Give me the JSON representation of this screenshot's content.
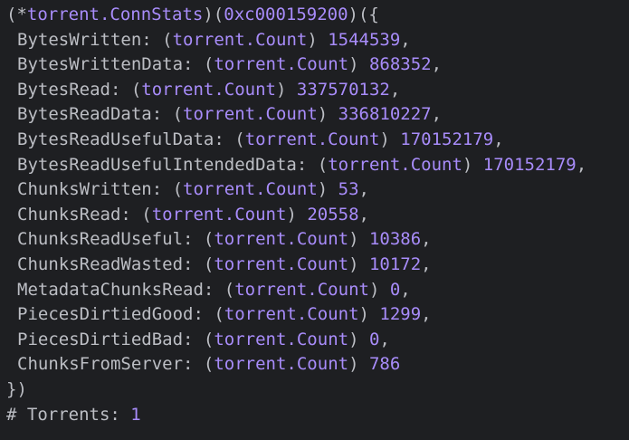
{
  "header": {
    "open_paren": "(*",
    "type_name": "torrent.ConnStats",
    "close_paren": ")(",
    "address": "0xc000159200",
    "suffix": ")({"
  },
  "fields": [
    {
      "name": "BytesWritten",
      "type": "torrent.Count",
      "value": "1544539",
      "sep": ","
    },
    {
      "name": "BytesWrittenData",
      "type": "torrent.Count",
      "value": "868352",
      "sep": ","
    },
    {
      "name": "BytesRead",
      "type": "torrent.Count",
      "value": "337570132",
      "sep": ","
    },
    {
      "name": "BytesReadData",
      "type": "torrent.Count",
      "value": "336810227",
      "sep": ","
    },
    {
      "name": "BytesReadUsefulData",
      "type": "torrent.Count",
      "value": "170152179",
      "sep": ","
    },
    {
      "name": "BytesReadUsefulIntendedData",
      "type": "torrent.Count",
      "value": "170152179",
      "sep": ","
    },
    {
      "name": "ChunksWritten",
      "type": "torrent.Count",
      "value": "53",
      "sep": ","
    },
    {
      "name": "ChunksRead",
      "type": "torrent.Count",
      "value": "20558",
      "sep": ","
    },
    {
      "name": "ChunksReadUseful",
      "type": "torrent.Count",
      "value": "10386",
      "sep": ","
    },
    {
      "name": "ChunksReadWasted",
      "type": "torrent.Count",
      "value": "10172",
      "sep": ","
    },
    {
      "name": "MetadataChunksRead",
      "type": "torrent.Count",
      "value": "0",
      "sep": ","
    },
    {
      "name": "PiecesDirtiedGood",
      "type": "torrent.Count",
      "value": "1299",
      "sep": ","
    },
    {
      "name": "PiecesDirtiedBad",
      "type": "torrent.Count",
      "value": "0",
      "sep": ","
    },
    {
      "name": "ChunksFromServer",
      "type": "torrent.Count",
      "value": "786",
      "sep": ""
    }
  ],
  "footer": {
    "closing": "})",
    "torrents_label": "# Torrents: ",
    "torrents_count": "1"
  },
  "colors": {
    "background": "#1e1f22",
    "text": "#bcbec4",
    "accent": "#a88cfa"
  }
}
